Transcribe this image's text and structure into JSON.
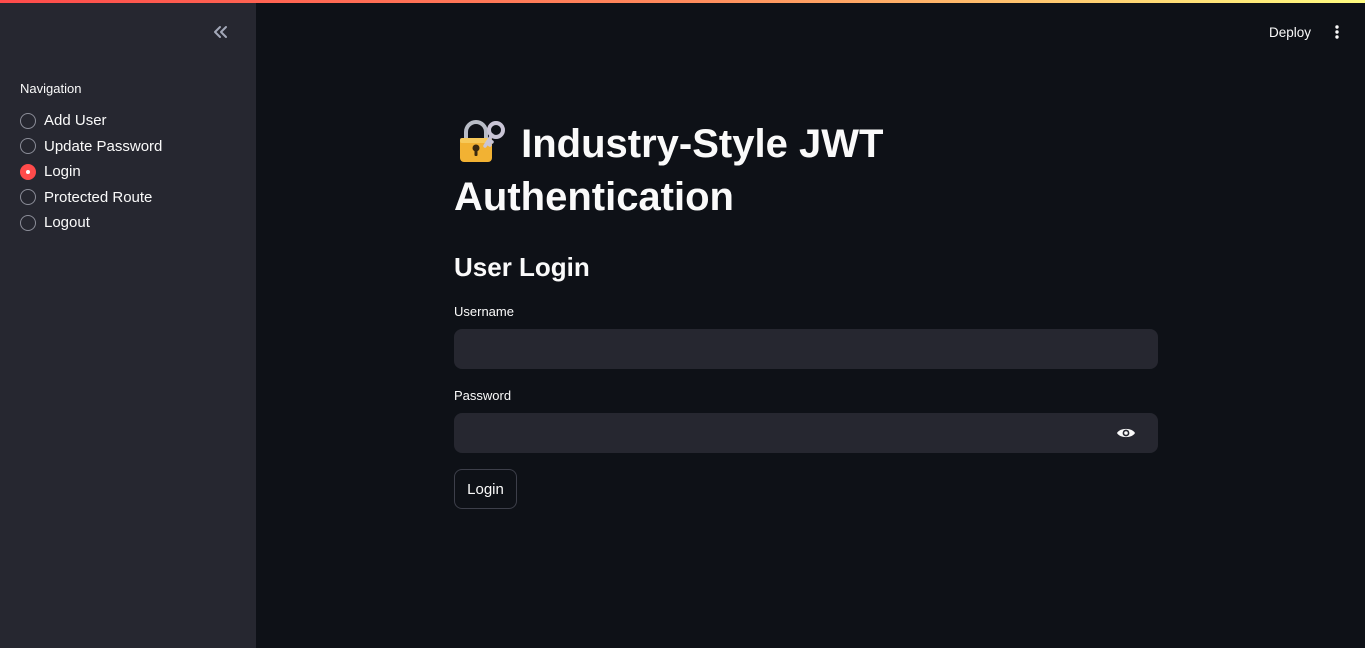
{
  "header": {
    "deploy_label": "Deploy",
    "menu_icon": "more-vertical-icon"
  },
  "sidebar": {
    "collapse_icon": "chevron-double-left-icon",
    "nav_title": "Navigation",
    "items": [
      {
        "label": "Add User",
        "selected": false
      },
      {
        "label": "Update Password",
        "selected": false
      },
      {
        "label": "Login",
        "selected": true
      },
      {
        "label": "Protected Route",
        "selected": false
      },
      {
        "label": "Logout",
        "selected": false
      }
    ]
  },
  "main": {
    "title_icon": "locked-with-key-icon",
    "title": "Industry-Style JWT Authentication",
    "subtitle": "User Login",
    "username": {
      "label": "Username",
      "value": ""
    },
    "password": {
      "label": "Password",
      "value": "",
      "toggle_icon": "eye-icon"
    },
    "login_button": "Login"
  },
  "colors": {
    "accent": "#ff4b4b",
    "background": "#0e1117",
    "sidebar_bg": "#262730",
    "input_bg": "#262730",
    "text": "#fafafa"
  }
}
